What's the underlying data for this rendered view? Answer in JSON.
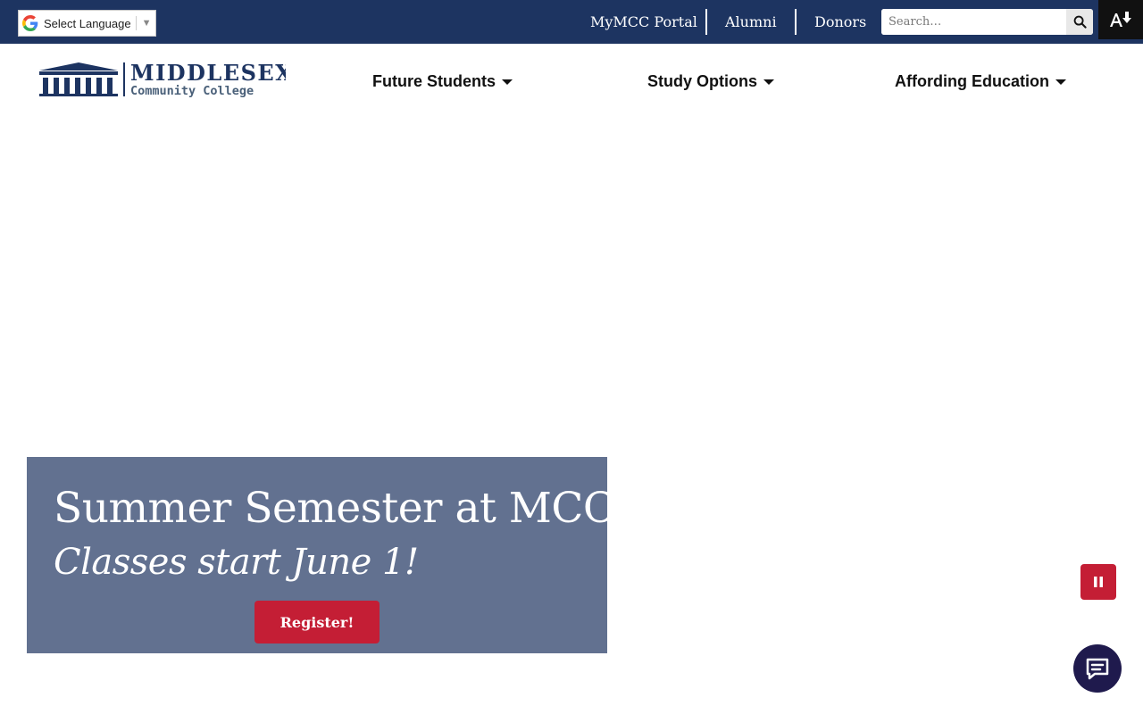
{
  "colors": {
    "topbar": "#1d3461",
    "accent_red": "#c41e35",
    "hero_panel": "#627190",
    "chat_bubble": "#1f1a4d"
  },
  "language": {
    "label": "Select Language",
    "icon": "google-g-icon"
  },
  "utility_nav": {
    "portal": "MyMCC Portal",
    "alumni": "Alumni",
    "donors": "Donors"
  },
  "search": {
    "placeholder": "Search…",
    "icon": "search-icon"
  },
  "accessibility": {
    "icon": "text-resize-icon"
  },
  "logo": {
    "name": "MIDDLESEX",
    "subtitle": "Community College"
  },
  "main_nav": {
    "future_students": "Future Students",
    "study_options": "Study Options",
    "affording_education": "Affording Education"
  },
  "hero": {
    "title": "Summer Semester at MCC",
    "subtitle": "Classes start June 1!",
    "cta": "Register!"
  },
  "slider": {
    "pause_icon": "pause-icon"
  },
  "chat": {
    "icon": "chat-icon"
  }
}
